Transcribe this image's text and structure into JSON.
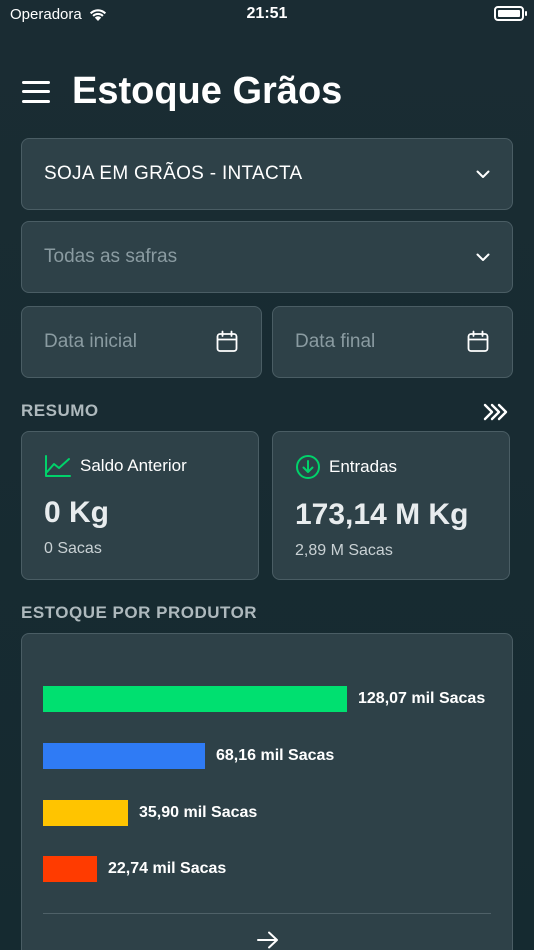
{
  "status_bar": {
    "carrier": "Operadora",
    "time": "21:51"
  },
  "header": {
    "title": "Estoque Grãos"
  },
  "filters": {
    "product": "SOJA EM GRÃOS - INTACTA",
    "harvest_placeholder": "Todas as safras",
    "start_date_placeholder": "Data inicial",
    "end_date_placeholder": "Data final"
  },
  "summary": {
    "title": "RESUMO",
    "cards": [
      {
        "label": "Saldo Anterior",
        "value": "0 Kg",
        "sub": "0 Sacas",
        "icon": "chart-line-icon"
      },
      {
        "label": "Entradas",
        "value": "173,14 M Kg",
        "sub": "2,89 M Sacas",
        "icon": "arrow-down-circle-icon"
      }
    ]
  },
  "producer_stock": {
    "title": "ESTOQUE POR PRODUTOR",
    "bars": [
      {
        "label": "128,07 mil Sacas",
        "value": 128.07,
        "color": "#00e070"
      },
      {
        "label": "68,16 mil Sacas",
        "value": 68.16,
        "color": "#2f7bf5"
      },
      {
        "label": "35,90 mil Sacas",
        "value": 35.9,
        "color": "#ffc400"
      },
      {
        "label": "22,74 mil Sacas",
        "value": 22.74,
        "color": "#ff3b00"
      }
    ]
  },
  "colors": {
    "accent_green": "#00d26a",
    "background": "#1a2c33",
    "card": "#2e4148"
  }
}
